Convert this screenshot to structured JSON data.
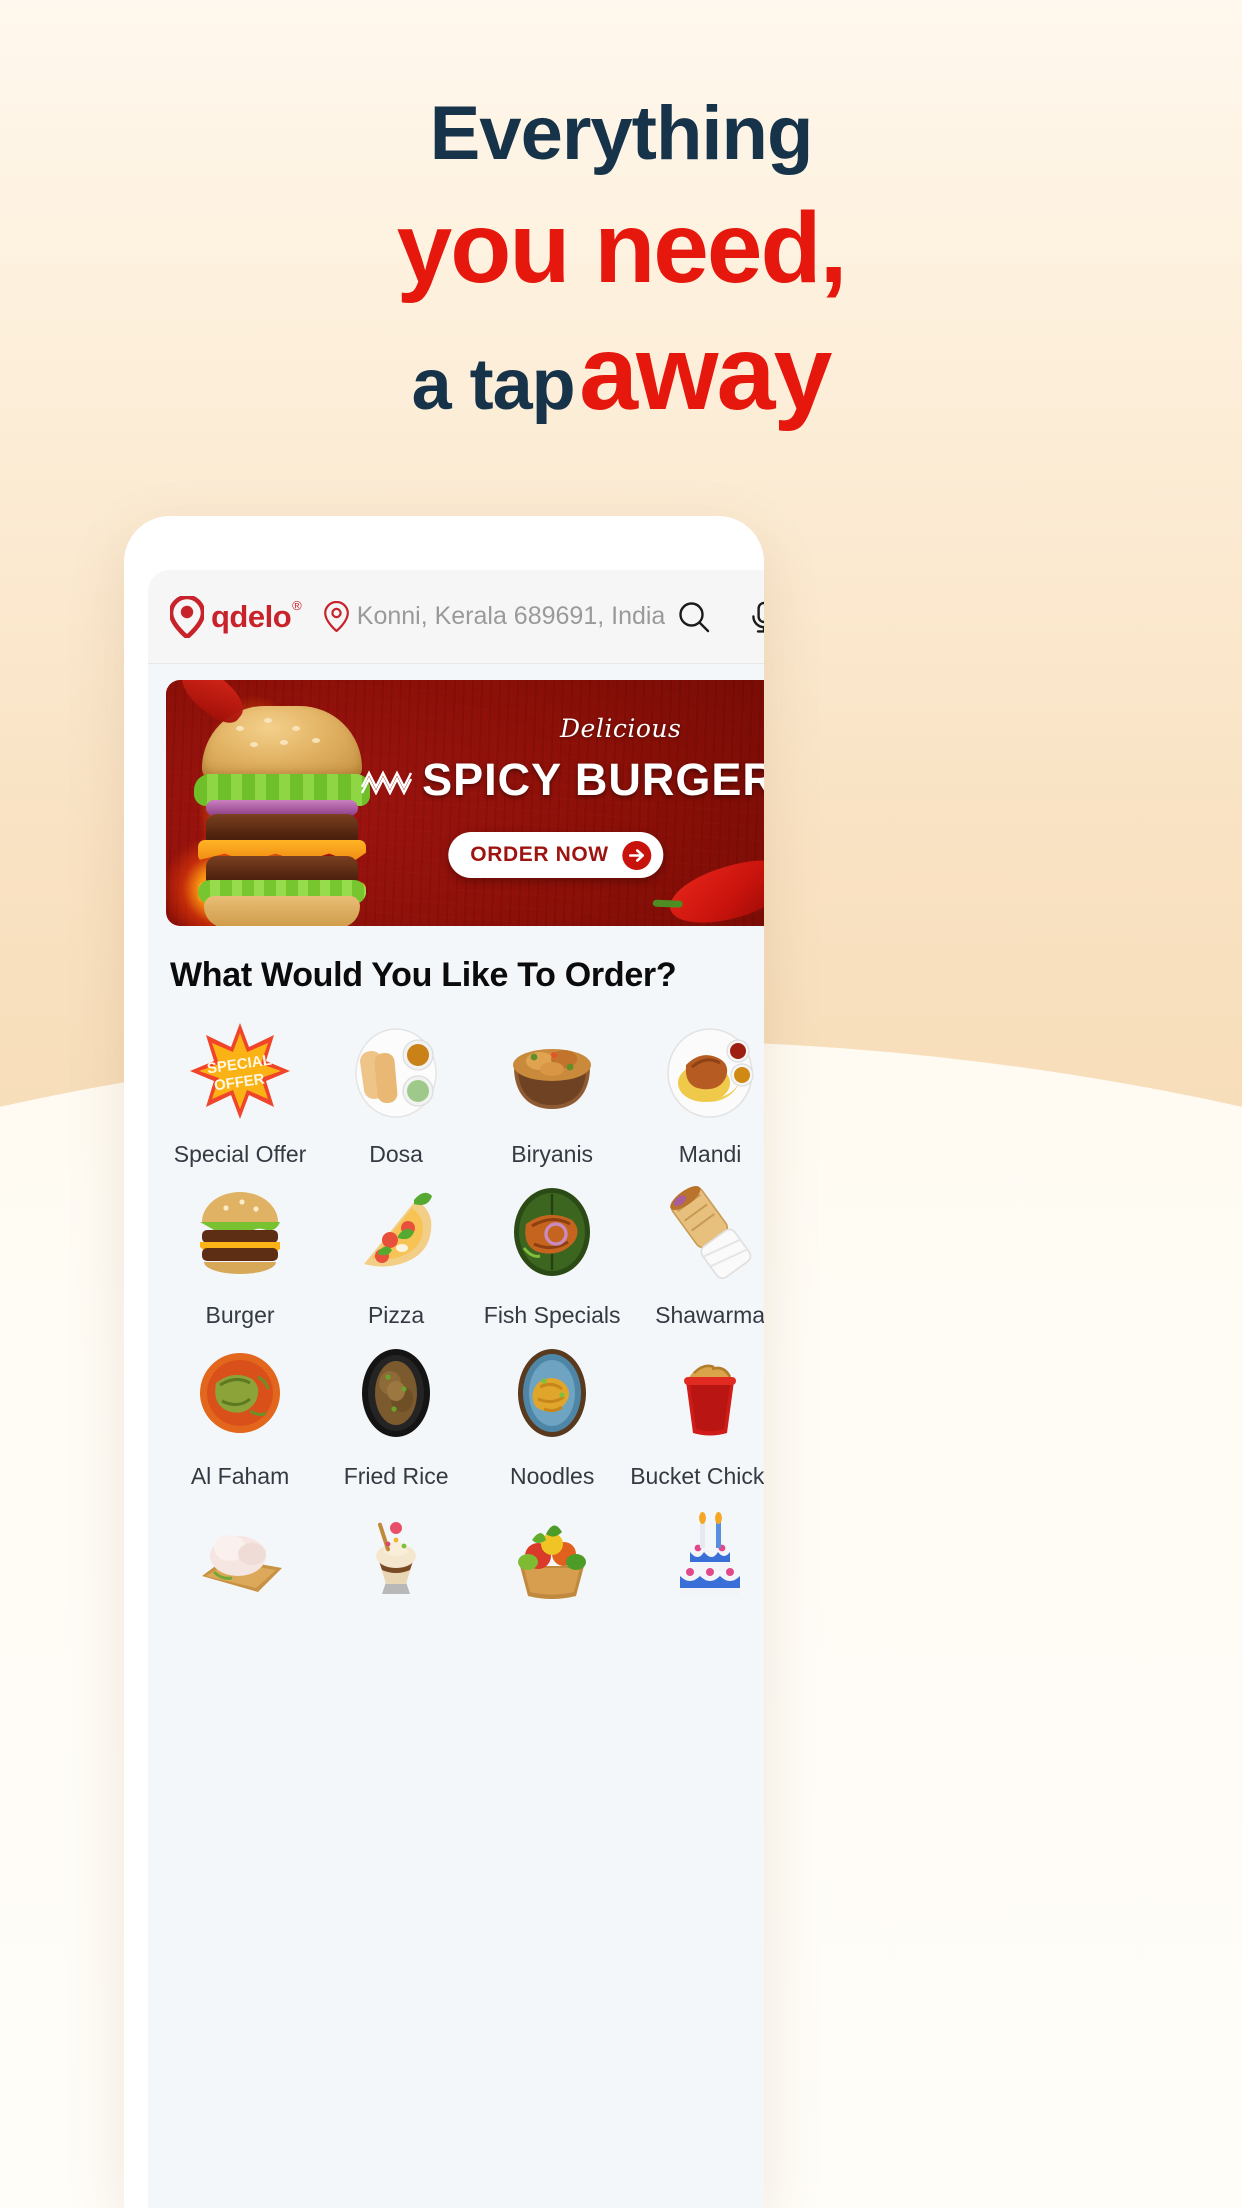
{
  "theme": {
    "bg_cream": "#FDF0DC",
    "accent_red": "#E6170D",
    "navy": "#17334A",
    "brand_red": "#C8232B",
    "banner_red": "#8C1008",
    "screen_bg": "#F4F7FA"
  },
  "headline": {
    "line1": "Everything",
    "line2": "you need,",
    "line3_dark": "a tap",
    "line3_red": "away"
  },
  "app": {
    "header": {
      "brand_name": "qdelo",
      "brand_trademark": "®",
      "brand_pin_icon": "location-pin-icon",
      "location_icon": "map-marker-icon",
      "location_text": "Konni, Kerala 689691, India",
      "search_icon": "search-icon",
      "mic_icon": "microphone-icon"
    },
    "banner": {
      "eyebrow": "Delicious",
      "title": "SPICY BURGER",
      "cta_label": "ORDER NOW",
      "cta_icon": "arrow-right-circle-icon",
      "decor_left_icon": "zigzag-icon",
      "decor_right_icon": "zigzag-icon"
    },
    "section_title": "What Would You Like To Order?",
    "categories": [
      {
        "label": "Special Offer",
        "icon": "special-offer-burst-icon"
      },
      {
        "label": "Dosa",
        "icon": "dosa-plate-icon"
      },
      {
        "label": "Biryanis",
        "icon": "biryani-bowl-icon"
      },
      {
        "label": "Mandi",
        "icon": "mandi-platter-icon"
      },
      {
        "label": "Burger",
        "icon": "burger-icon"
      },
      {
        "label": "Pizza",
        "icon": "pizza-slice-icon"
      },
      {
        "label": "Fish Specials",
        "icon": "fish-leaf-icon"
      },
      {
        "label": "Shawarma",
        "icon": "shawarma-wrap-icon"
      },
      {
        "label": "Al Faham",
        "icon": "al-faham-plate-icon"
      },
      {
        "label": "Fried Rice",
        "icon": "fried-rice-bowl-icon"
      },
      {
        "label": "Noodles",
        "icon": "noodles-bowl-icon"
      },
      {
        "label": "Bucket Chicken",
        "icon": "chicken-bucket-icon"
      },
      {
        "label": "",
        "icon": "raw-chicken-board-icon"
      },
      {
        "label": "",
        "icon": "ice-cream-sundae-icon"
      },
      {
        "label": "",
        "icon": "vegetables-basket-icon"
      },
      {
        "label": "",
        "icon": "birthday-cake-icon"
      }
    ]
  }
}
